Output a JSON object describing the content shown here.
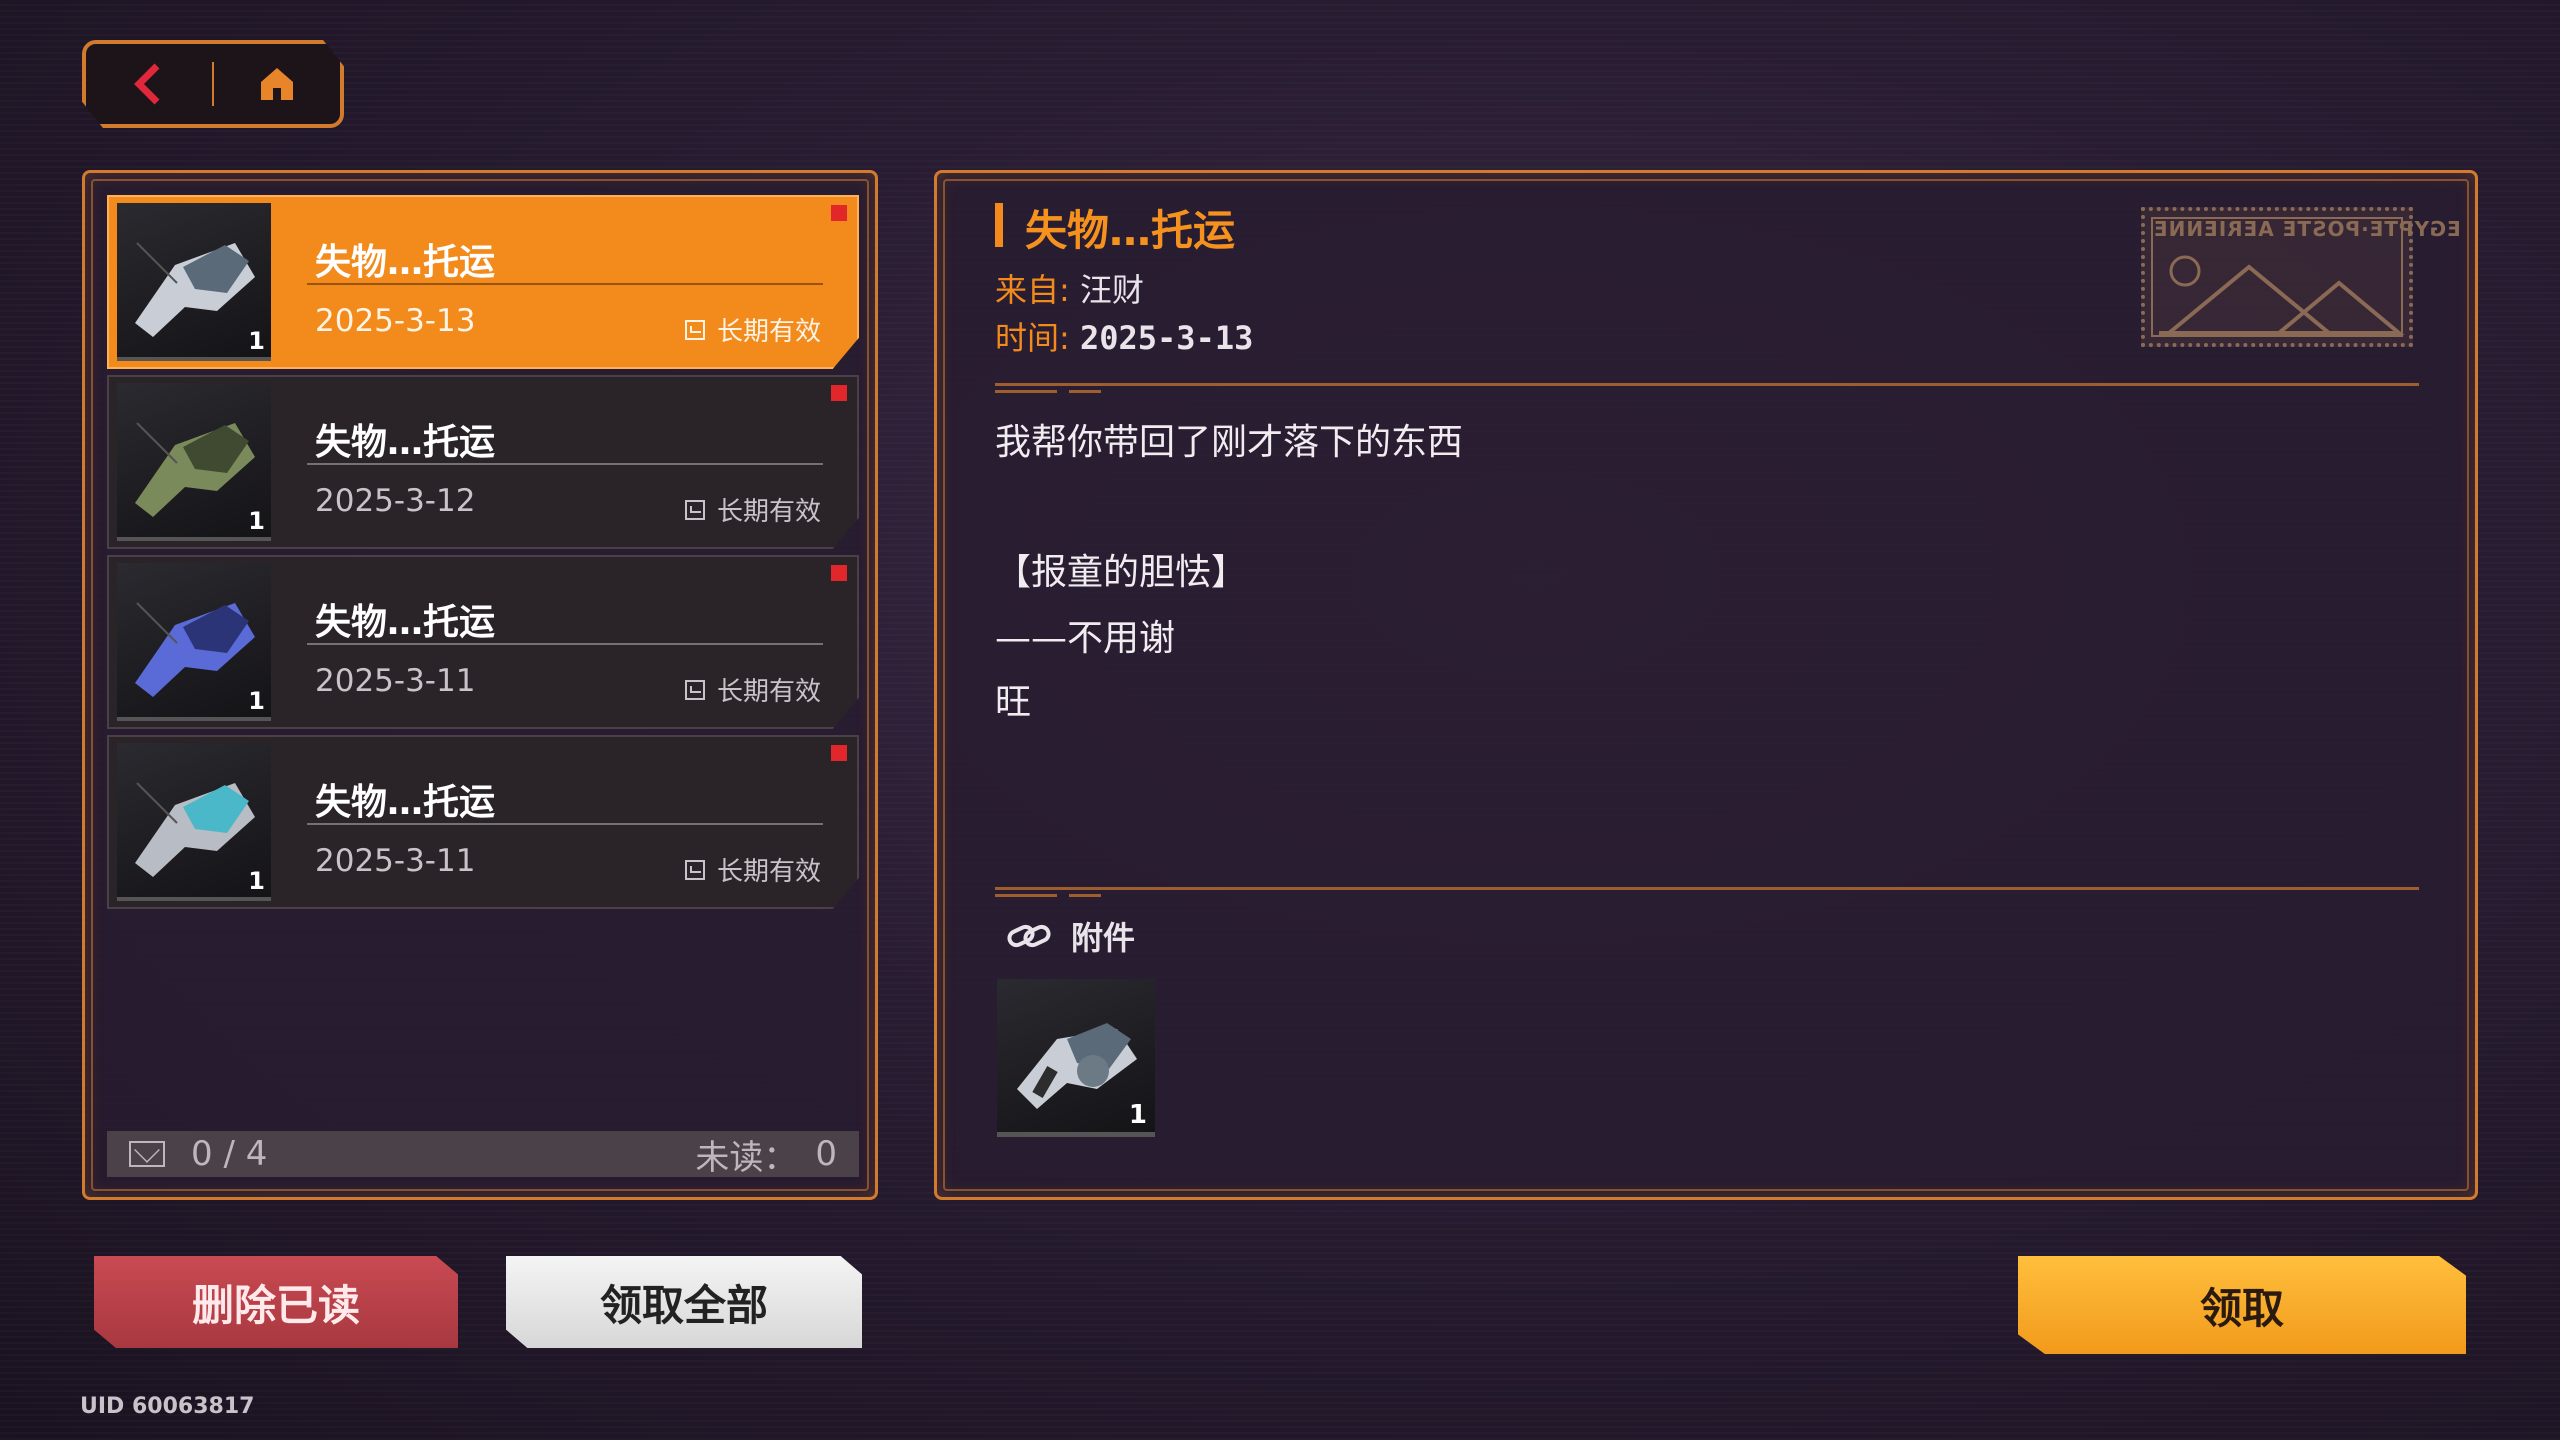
{
  "nav": {
    "back_icon": "chevron-left-icon",
    "home_icon": "home-icon"
  },
  "mail_list": {
    "items": [
      {
        "title": "失物…托运",
        "date": "2025-3-13",
        "expiry": "长期有效",
        "count": "1",
        "unread": true,
        "selected": true
      },
      {
        "title": "失物…托运",
        "date": "2025-3-12",
        "expiry": "长期有效",
        "count": "1",
        "unread": true,
        "selected": false
      },
      {
        "title": "失物…托运",
        "date": "2025-3-11",
        "expiry": "长期有效",
        "count": "1",
        "unread": true,
        "selected": false
      },
      {
        "title": "失物…托运",
        "date": "2025-3-11",
        "expiry": "长期有效",
        "count": "1",
        "unread": true,
        "selected": false
      }
    ],
    "footer": {
      "counter": "0 / 4",
      "unread_label": "未读：",
      "unread_value": "0"
    }
  },
  "mail_detail": {
    "title": "失物…托运",
    "from_label": "来自:",
    "from_value": "汪财",
    "time_label": "时间:",
    "time_value": "2025-3-13",
    "body": [
      "我帮你带回了刚才落下的东西",
      "【报童的胆怯】",
      "——不用谢",
      "旺"
    ],
    "attachment_label": "附件",
    "attachment_count": "1",
    "stamp_text": "EGYPTE·POSTE AERIENNE"
  },
  "actions": {
    "delete_read": "删除已读",
    "claim_all": "领取全部",
    "claim": "领取"
  },
  "uid": "UID 60063817",
  "colors": {
    "accent": "#f28a1c",
    "unread": "#e1272a",
    "delete": "#c94a52",
    "claim": "#ffb02e"
  }
}
